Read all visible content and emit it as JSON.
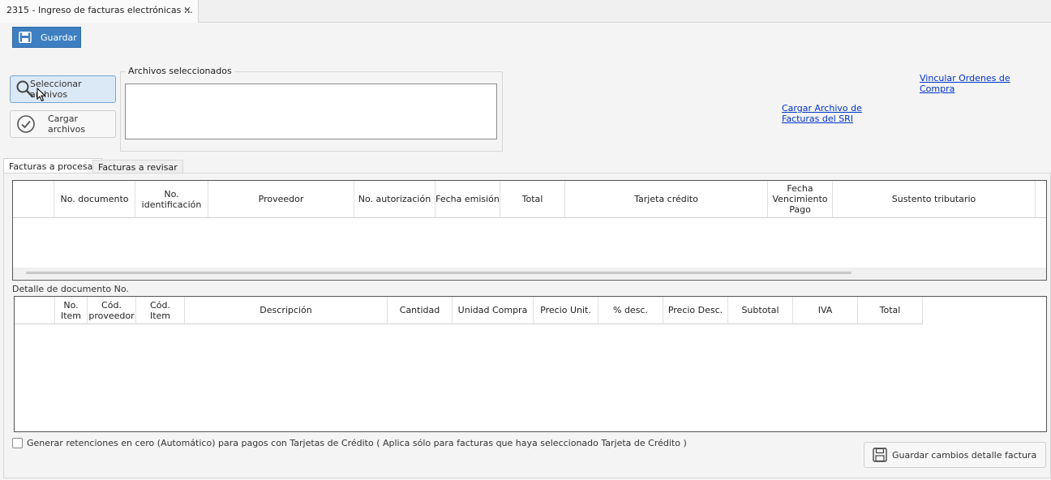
{
  "window": {
    "tab_title": "2315 - Ingreso de facturas electrónicas ::.",
    "close_glyph": "×"
  },
  "toolbar": {
    "save_label": "Guardar",
    "save_icon": "floppy-disk-icon"
  },
  "files": {
    "select_label": "Seleccionar archivos",
    "select_icon": "magnifier-icon",
    "load_label": "Cargar archivos",
    "load_icon": "check-circle-icon",
    "group_title": "Archivos seleccionados",
    "selected_files": ""
  },
  "links": {
    "link_orders_line1": "Vincular Ordenes de ",
    "link_orders_line2": "Compra",
    "link_sri_line1": "Cargar Archivo de ",
    "link_sri_line2": "Facturas del SRI"
  },
  "tabs": [
    {
      "label": "Facturas a procesar",
      "active": true
    },
    {
      "label": "Facturas a revisar",
      "active": false
    }
  ],
  "invoices_table": {
    "columns": [
      "",
      "No. documento",
      "No. identificación",
      "Proveedor",
      "No. autorización",
      "Fecha emisión",
      "Total",
      "Tarjeta crédito",
      "Fecha Vencimiento Pago",
      "Sustento tributario"
    ],
    "rows": []
  },
  "detail": {
    "caption": "Detalle de documento No.",
    "columns": [
      "",
      "No. Item",
      "Cód. proveedor",
      "Cód. Item",
      "Descripción",
      "Cantidad",
      "Unidad Compra",
      "Precio Unit.",
      "% desc.",
      "Precio Desc.",
      "Subtotal",
      "IVA",
      "Total"
    ],
    "rows": []
  },
  "options": {
    "zero_retention_label": "Generar retenciones en cero (Automático) para pagos con Tarjetas de Crédito ( Aplica sólo para facturas que haya seleccionado Tarjeta de Crédito )",
    "zero_retention_checked": false
  },
  "footer": {
    "save_detail_label": "Guardar cambios detalle factura",
    "save_detail_icon": "floppy-disk-icon"
  },
  "colors": {
    "primary_button": "#3d7fc1",
    "link": "#0033cc",
    "selected_button_bg": "#dbe8f5"
  }
}
